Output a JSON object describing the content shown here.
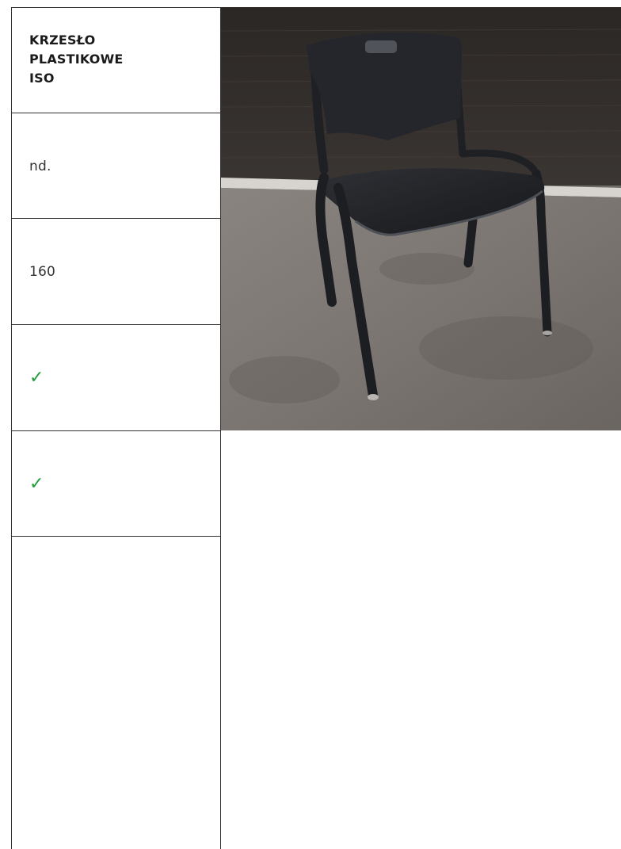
{
  "product": {
    "title": "KRZESŁO\nPLASTIKOWE\nISO",
    "row_2": "nd.",
    "row_3": "160",
    "row_4_check": "✓",
    "row_5_check": "✓"
  },
  "colors": {
    "check": "#1e9e3a",
    "border": "#333333"
  },
  "photo": {
    "subject": "black-plastic-stacking-chair"
  }
}
